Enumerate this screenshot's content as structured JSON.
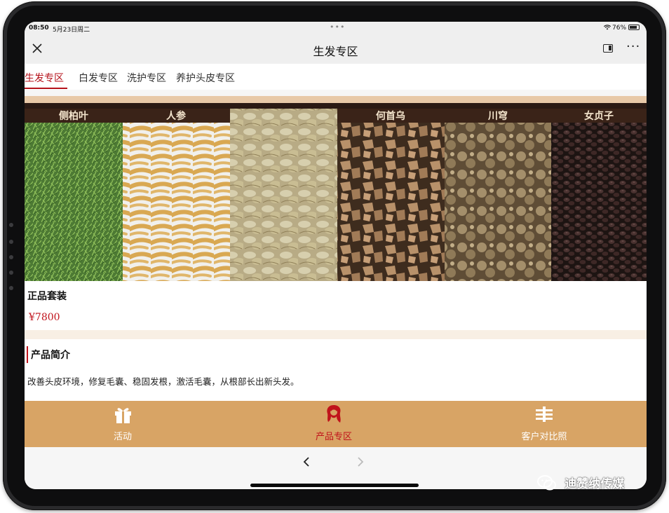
{
  "status": {
    "time": "08:50",
    "date": "5月23日周二",
    "battery": "76%"
  },
  "titlebar": {
    "title": "生发专区"
  },
  "tabs": [
    {
      "label": "生发专区"
    },
    {
      "label": "白发专区"
    },
    {
      "label": "洗护专区"
    },
    {
      "label": "养护头皮专区"
    }
  ],
  "banner": {
    "herbs": [
      {
        "label": "侧柏叶"
      },
      {
        "label": "人参"
      },
      {
        "label": ""
      },
      {
        "label": "何首乌"
      },
      {
        "label": "川穹"
      },
      {
        "label": "女贞子"
      }
    ]
  },
  "product": {
    "name": "正品套装",
    "price": "¥7800"
  },
  "intro": {
    "heading": "产品简介",
    "description": "改善头皮环境，修复毛囊、稳固发根，激活毛囊，从根部长出新头发。"
  },
  "tabbar": {
    "items": [
      {
        "label": "活动",
        "icon": "gift-icon"
      },
      {
        "label": "产品专区",
        "icon": "hair-icon"
      },
      {
        "label": "客户对比照",
        "icon": "compare-icon"
      }
    ],
    "accent": "#c0131b",
    "background": "#d8a465"
  },
  "watermark": {
    "text": "迪赞纳传媒"
  }
}
